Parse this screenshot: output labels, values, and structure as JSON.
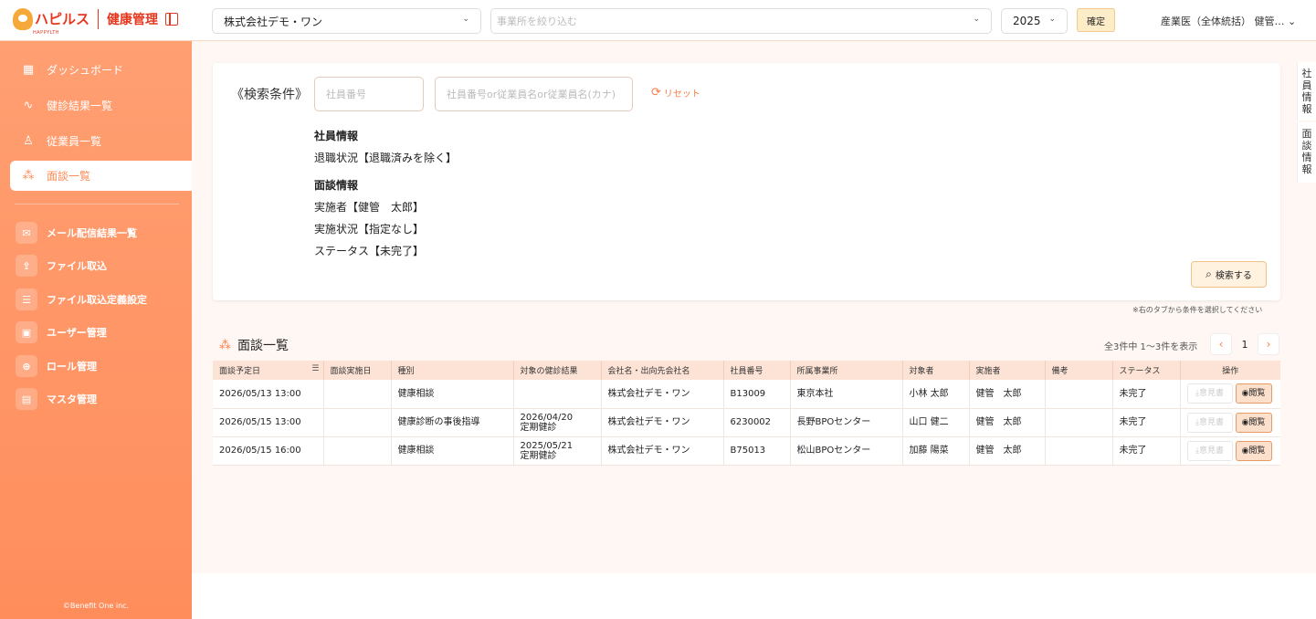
{
  "brand": {
    "name": "ハピルス",
    "sub": "HAPPYLTH",
    "app": "健康管理"
  },
  "topbar": {
    "company": "株式会社デモ・ワン",
    "office_placeholder": "事業所を絞り込む",
    "year": "2025",
    "confirm": "確定",
    "user": "産業医（全体統括） 健管…"
  },
  "sidebar": {
    "main": [
      {
        "label": "ダッシュボード",
        "icon": "dashboard-icon"
      },
      {
        "label": "健診結果一覧",
        "icon": "pulse-icon"
      },
      {
        "label": "従業員一覧",
        "icon": "person-icon"
      },
      {
        "label": "面談一覧",
        "icon": "group-icon"
      }
    ],
    "admin": [
      {
        "label": "メール配信結果一覧",
        "icon": "mail-icon"
      },
      {
        "label": "ファイル取込",
        "icon": "upload-icon"
      },
      {
        "label": "ファイル取込定義設定",
        "icon": "sliders-icon"
      },
      {
        "label": "ユーザー管理",
        "icon": "user-card-icon"
      },
      {
        "label": "ロール管理",
        "icon": "role-icon"
      },
      {
        "label": "マスタ管理",
        "icon": "master-icon"
      }
    ],
    "copyright": "©Benefit One inc."
  },
  "search": {
    "title": "《検索条件》",
    "employee_no_placeholder": "社員番号",
    "name_placeholder": "社員番号or従業員名or従業員名(カナ)",
    "reset": "リセット",
    "groups": [
      {
        "heading": "社員情報",
        "items": [
          "退職状況【退職済みを除く】"
        ]
      },
      {
        "heading": "面談情報",
        "items": [
          "実施者【健管　太郎】",
          "実施状況【指定なし】",
          "ステータス【未完了】"
        ]
      }
    ],
    "search_button": "検索する",
    "note": "※右のタブから条件を選択してください"
  },
  "list": {
    "title": "面談一覧",
    "pager_info": "全3件中 1〜3件を表示",
    "page": "1",
    "headers": [
      "面談予定日",
      "面談実施日",
      "種別",
      "対象の健診結果",
      "会社名・出向先会社名",
      "社員番号",
      "所属事業所",
      "対象者",
      "実施者",
      "備考",
      "ステータス",
      "操作"
    ],
    "rows": [
      {
        "date": "2026/05/13 13:00",
        "done": "",
        "type": "健康相談",
        "exam1": "",
        "exam2": "",
        "company": "株式会社デモ・ワン",
        "emp": "B13009",
        "office": "東京本社",
        "target": "小林 太郎",
        "doer": "健管　太郎",
        "memo": "",
        "status": "未完了"
      },
      {
        "date": "2026/05/15 13:00",
        "done": "",
        "type": "健康診断の事後指導",
        "exam1": "2026/04/20",
        "exam2": "定期健診",
        "company": "株式会社デモ・ワン",
        "emp": "6230002",
        "office": "長野BPOセンター",
        "target": "山口 健二",
        "doer": "健管　太郎",
        "memo": "",
        "status": "未完了"
      },
      {
        "date": "2026/05/15 16:00",
        "done": "",
        "type": "健康相談",
        "exam1": "2025/05/21",
        "exam2": "定期健診",
        "company": "株式会社デモ・ワン",
        "emp": "B75013",
        "office": "松山BPOセンター",
        "target": "加藤 陽菜",
        "doer": "健管　太郎",
        "memo": "",
        "status": "未完了"
      }
    ],
    "opinion_btn": "意見書",
    "view_btn": "閲覧"
  },
  "right_tabs": [
    "社員情報",
    "面談情報"
  ]
}
